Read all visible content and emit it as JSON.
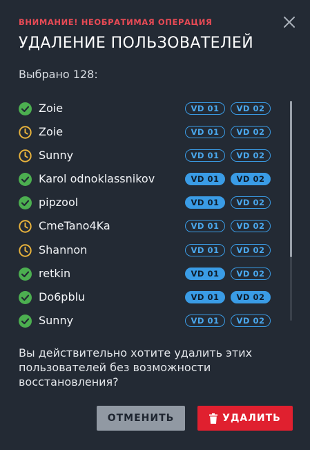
{
  "dialog": {
    "warning": "ВНИМАНИЕ! НЕОБРАТИМАЯ ОПЕРАЦИЯ",
    "title": "УДАЛЕНИЕ ПОЛЬЗОВАТЕЛЕЙ",
    "selected_text": "Выбрано 128:",
    "confirm_text": "Вы действительно хотите удалить этих пользователей без возможности восстановления?",
    "cancel_label": "ОТМЕНИТЬ",
    "delete_label": "УДАЛИТЬ"
  },
  "colors": {
    "background": "#232a34",
    "warning": "#e84a55",
    "ok": "#4caf50",
    "pending": "#e8b33c",
    "badge_blue": "#3a9ce6",
    "delete_red": "#e0202f",
    "cancel_gray": "#9199a3"
  },
  "users": [
    {
      "name": "Zoie",
      "status": "ok",
      "vd01": "VD 01",
      "vd02": "VD 02",
      "vd01_active": false,
      "vd02_active": false
    },
    {
      "name": "Zoie",
      "status": "pending",
      "vd01": "VD 01",
      "vd02": "VD 02",
      "vd01_active": false,
      "vd02_active": false
    },
    {
      "name": "Sunny",
      "status": "pending",
      "vd01": "VD 01",
      "vd02": "VD 02",
      "vd01_active": false,
      "vd02_active": false
    },
    {
      "name": "Karol odnoklassnikov",
      "status": "ok",
      "vd01": "VD 01",
      "vd02": "VD 02",
      "vd01_active": true,
      "vd02_active": true
    },
    {
      "name": "pipzool",
      "status": "ok",
      "vd01": "VD 01",
      "vd02": "VD 02",
      "vd01_active": true,
      "vd02_active": false
    },
    {
      "name": "CmeTano4Ka",
      "status": "pending",
      "vd01": "VD 01",
      "vd02": "VD 02",
      "vd01_active": false,
      "vd02_active": false
    },
    {
      "name": "Shannon",
      "status": "pending",
      "vd01": "VD 01",
      "vd02": "VD 02",
      "vd01_active": false,
      "vd02_active": false
    },
    {
      "name": "retkin",
      "status": "ok",
      "vd01": "VD 01",
      "vd02": "VD 02",
      "vd01_active": true,
      "vd02_active": false
    },
    {
      "name": "Do6pblu",
      "status": "ok",
      "vd01": "VD 01",
      "vd02": "VD 02",
      "vd01_active": true,
      "vd02_active": true
    },
    {
      "name": "Sunny",
      "status": "ok",
      "vd01": "VD 01",
      "vd02": "VD 02",
      "vd01_active": false,
      "vd02_active": false
    }
  ]
}
